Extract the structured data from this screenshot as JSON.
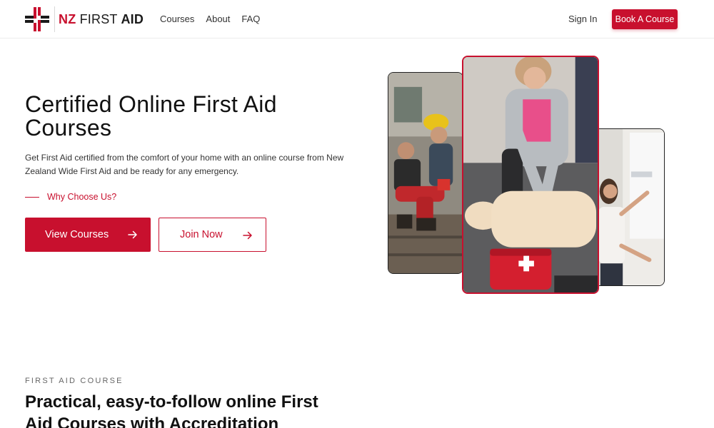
{
  "brand": {
    "name_nz": "NZ",
    "name_first": "FIRST",
    "name_aid": "AID",
    "accent_color": "#c8102e"
  },
  "nav": {
    "items": [
      {
        "label": "Courses"
      },
      {
        "label": "About"
      },
      {
        "label": "FAQ"
      }
    ]
  },
  "header": {
    "sign_in": "Sign In",
    "book_button": "Book A Course"
  },
  "hero": {
    "title": "Certified Online First Aid Courses",
    "description": "Get First Aid certified from the comfort of your home with an online course from New Zealand Wide First Aid and be ready for any emergency.",
    "why_link": "Why Choose Us?",
    "primary_button": "View Courses",
    "secondary_button": "Join Now",
    "images": [
      {
        "name": "photo-workplace-first-aid"
      },
      {
        "name": "photo-cpr-training"
      },
      {
        "name": "photo-classroom-instructor"
      }
    ]
  },
  "section": {
    "eyebrow": "FIRST AID COURSE",
    "title": "Practical, easy-to-follow online First Aid Courses with Accreditation"
  },
  "icons": {
    "arrow": "arrow-right-icon",
    "logo": "cross-logo-icon"
  }
}
